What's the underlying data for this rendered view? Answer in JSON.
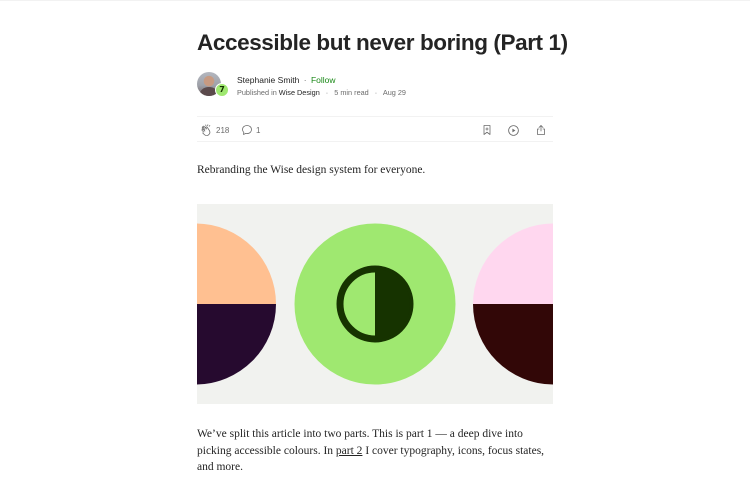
{
  "article": {
    "title": "Accessible but never boring (Part 1)",
    "subtitle": "Rebranding the Wise design system for everyone.",
    "body": {
      "before_link": "We’ve split this article into two parts. This is part 1 — a deep dive into picking accessible colours. In ",
      "link_text": "part 2",
      "after_link": " I cover typography, icons, focus states, and more."
    }
  },
  "byline": {
    "author": "Stephanie Smith",
    "separator": "·",
    "follow_label": "Follow",
    "published_in_label": "Published in",
    "publication": "Wise Design",
    "publication_badge": "7",
    "read_time": "5 min read",
    "date": "Aug 29"
  },
  "actions": {
    "clap_count": "218",
    "response_count": "1",
    "icons": [
      "clap-icon",
      "response-icon",
      "bookmark-icon",
      "play-icon",
      "share-icon"
    ]
  },
  "hero_colors": {
    "background": "#f1f2ef",
    "left_top": "#ffc091",
    "left_bottom": "#260a2f",
    "center_circle": "#9fe870",
    "contrast_symbol": "#163300",
    "right_top": "#ffd7ef",
    "right_bottom": "#320707"
  },
  "colors": {
    "follow": "#1a8917",
    "text": "#242424",
    "muted": "#6b6b6b"
  }
}
